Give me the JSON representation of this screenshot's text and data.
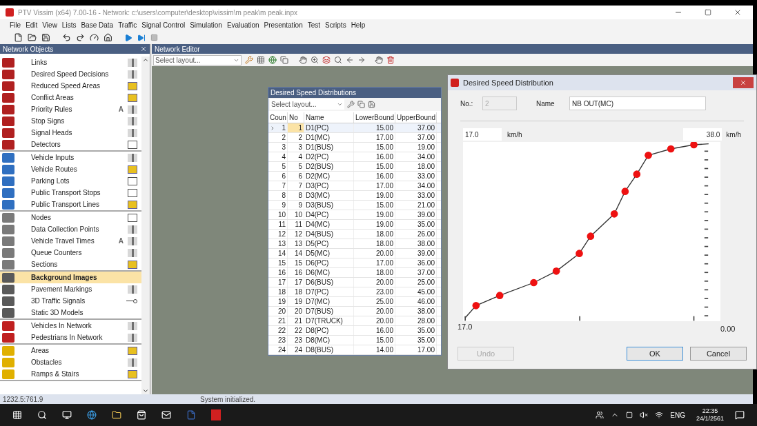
{
  "window": {
    "title": "PTV Vissim (x64) 7.00-16 - Network: c:\\users\\computer\\desktop\\vissim\\m peak\\m peak.inpx"
  },
  "menu": [
    "File",
    "Edit",
    "View",
    "Lists",
    "Base Data",
    "Traffic",
    "Signal Control",
    "Simulation",
    "Evaluation",
    "Presentation",
    "Test",
    "Scripts",
    "Help"
  ],
  "network_objects": {
    "title": "Network Objects",
    "groups": [
      [
        {
          "label": "Links",
          "selected": false,
          "kind": "bar"
        },
        {
          "label": "Desired Speed Decisions",
          "selected": false,
          "kind": "bar"
        },
        {
          "label": "Reduced Speed Areas",
          "selected": false,
          "kind": "fill"
        },
        {
          "label": "Conflict Areas",
          "selected": false,
          "kind": "fill"
        },
        {
          "label": "Priority Rules",
          "selected": false,
          "kind": "bar",
          "marker": "A"
        },
        {
          "label": "Stop Signs",
          "selected": false,
          "kind": "bar"
        },
        {
          "label": "Signal Heads",
          "selected": false,
          "kind": "bar"
        },
        {
          "label": "Detectors",
          "selected": false,
          "kind": "outline"
        }
      ],
      [
        {
          "label": "Vehicle Inputs",
          "selected": false,
          "kind": "bar"
        },
        {
          "label": "Vehicle Routes",
          "selected": false,
          "kind": "fill"
        },
        {
          "label": "Parking Lots",
          "selected": false,
          "kind": "outline"
        },
        {
          "label": "Public Transport Stops",
          "selected": false,
          "kind": "outline"
        },
        {
          "label": "Public Transport Lines",
          "selected": false,
          "kind": "fill"
        }
      ],
      [
        {
          "label": "Nodes",
          "selected": false,
          "kind": "outline"
        },
        {
          "label": "Data Collection Points",
          "selected": false,
          "kind": "bar"
        },
        {
          "label": "Vehicle Travel Times",
          "selected": false,
          "kind": "bar",
          "marker": "A"
        },
        {
          "label": "Queue Counters",
          "selected": false,
          "kind": "bar"
        },
        {
          "label": "Sections",
          "selected": false,
          "kind": "fill"
        }
      ],
      [
        {
          "label": "Background Images",
          "selected": true,
          "kind": "plain"
        },
        {
          "label": "Pavement Markings",
          "selected": false,
          "kind": "bar"
        },
        {
          "label": "3D Traffic Signals",
          "selected": false,
          "kind": "pin"
        },
        {
          "label": "Static 3D Models",
          "selected": false,
          "kind": "plain"
        }
      ],
      [
        {
          "label": "Vehicles In Network",
          "selected": false,
          "kind": "bar"
        },
        {
          "label": "Pedestrians In Network",
          "selected": false,
          "kind": "bar"
        }
      ],
      [
        {
          "label": "Areas",
          "selected": false,
          "kind": "fill"
        },
        {
          "label": "Obstacles",
          "selected": false,
          "kind": "bar"
        },
        {
          "label": "Ramps & Stairs",
          "selected": false,
          "kind": "fill"
        }
      ]
    ]
  },
  "network_editor": {
    "title": "Network Editor",
    "layout_select": "Select layout..."
  },
  "speed_distributions": {
    "title": "Desired Speed Distributions",
    "layout_select": "Select layout...",
    "columns": [
      "Coun",
      "No",
      "Name",
      "LowerBound",
      "UpperBound"
    ],
    "rows": [
      {
        "cells": [
          "1",
          "1",
          "D1(PC)",
          "15.00",
          "37.00"
        ],
        "selected": true
      },
      {
        "cells": [
          "2",
          "2",
          "D1(MC)",
          "17.00",
          "37.00"
        ],
        "selected": false
      },
      {
        "cells": [
          "3",
          "3",
          "D1(BUS)",
          "15.00",
          "19.00"
        ],
        "selected": false
      },
      {
        "cells": [
          "4",
          "4",
          "D2(PC)",
          "16.00",
          "34.00"
        ],
        "selected": false
      },
      {
        "cells": [
          "5",
          "5",
          "D2(BUS)",
          "15.00",
          "18.00"
        ],
        "selected": false
      },
      {
        "cells": [
          "6",
          "6",
          "D2(MC)",
          "16.00",
          "33.00"
        ],
        "selected": false
      },
      {
        "cells": [
          "7",
          "7",
          "D3(PC)",
          "17.00",
          "34.00"
        ],
        "selected": false
      },
      {
        "cells": [
          "8",
          "8",
          "D3(MC)",
          "19.00",
          "33.00"
        ],
        "selected": false
      },
      {
        "cells": [
          "9",
          "9",
          "D3(BUS)",
          "15.00",
          "21.00"
        ],
        "selected": false
      },
      {
        "cells": [
          "10",
          "10",
          "D4(PC)",
          "19.00",
          "39.00"
        ],
        "selected": false
      },
      {
        "cells": [
          "11",
          "11",
          "D4(MC)",
          "19.00",
          "35.00"
        ],
        "selected": false
      },
      {
        "cells": [
          "12",
          "12",
          "D4(BUS)",
          "18.00",
          "26.00"
        ],
        "selected": false
      },
      {
        "cells": [
          "13",
          "13",
          "D5(PC)",
          "18.00",
          "38.00"
        ],
        "selected": false
      },
      {
        "cells": [
          "14",
          "14",
          "D5(MC)",
          "20.00",
          "39.00"
        ],
        "selected": false
      },
      {
        "cells": [
          "15",
          "15",
          "D6(PC)",
          "17.00",
          "36.00"
        ],
        "selected": false
      },
      {
        "cells": [
          "16",
          "16",
          "D6(MC)",
          "18.00",
          "37.00"
        ],
        "selected": false
      },
      {
        "cells": [
          "17",
          "17",
          "D6(BUS)",
          "20.00",
          "25.00"
        ],
        "selected": false
      },
      {
        "cells": [
          "18",
          "18",
          "D7(PC)",
          "23.00",
          "45.00"
        ],
        "selected": false
      },
      {
        "cells": [
          "19",
          "19",
          "D7(MC)",
          "25.00",
          "46.00"
        ],
        "selected": false
      },
      {
        "cells": [
          "20",
          "20",
          "D7(BUS)",
          "20.00",
          "38.00"
        ],
        "selected": false
      },
      {
        "cells": [
          "21",
          "21",
          "D7(TRUCK)",
          "20.00",
          "28.00"
        ],
        "selected": false
      },
      {
        "cells": [
          "22",
          "22",
          "D8(PC)",
          "16.00",
          "35.00"
        ],
        "selected": false
      },
      {
        "cells": [
          "23",
          "23",
          "D8(MC)",
          "15.00",
          "35.00"
        ],
        "selected": false
      },
      {
        "cells": [
          "24",
          "24",
          "D8(BUS)",
          "14.00",
          "17.00"
        ],
        "selected": false
      }
    ]
  },
  "dialog": {
    "title": "Desired Speed Distribution",
    "number": {
      "label": "No.:",
      "value": "2",
      "disabled": true
    },
    "name": {
      "label": "Name",
      "value": "NB OUT(MC)"
    },
    "min": {
      "value": "17.0",
      "unit": "km/h"
    },
    "max": {
      "value": "38.0",
      "unit": "km/h"
    },
    "x_label": "17.0",
    "y_label": "0.00",
    "buttons": [
      {
        "label": "Undo",
        "disabled": true,
        "default": false
      },
      {
        "label": "OK",
        "disabled": false,
        "default": true
      },
      {
        "label": "Cancel",
        "disabled": false,
        "default": false
      }
    ]
  },
  "status_bar": {
    "coordinates": "1232.5:761.9",
    "message": "System initialized."
  },
  "taskbar": {
    "language": "ENG",
    "time": "22:35",
    "date": "24/1/2561"
  }
}
